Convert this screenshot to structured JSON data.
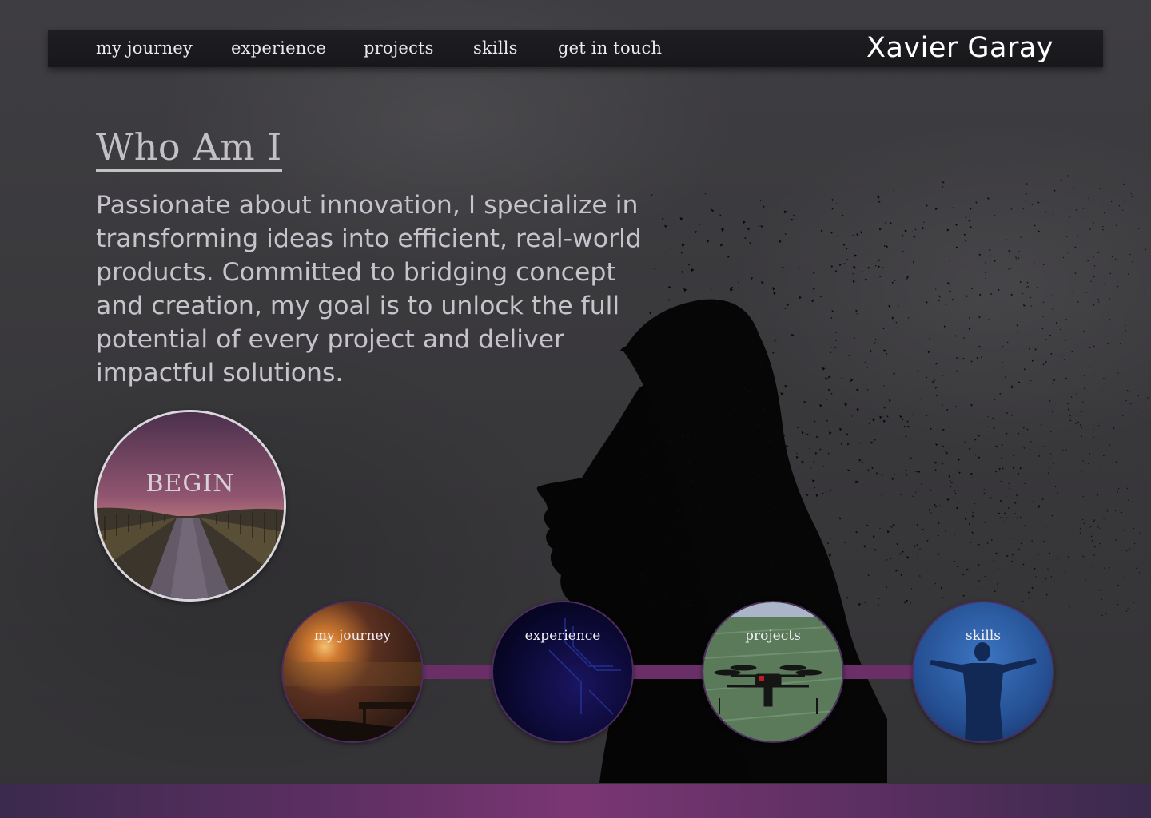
{
  "nav": {
    "links": [
      "my journey",
      "experience",
      "projects",
      "skills",
      "get in touch"
    ],
    "brand": "Xavier Garay"
  },
  "hero": {
    "title": "Who Am I",
    "intro": "Passionate about innovation, I specialize in transforming ideas into efficient, real-world products. Committed to bridging concept and creation, my goal is to unlock the full potential of every project and deliver impactful solutions."
  },
  "begin": {
    "label": "BEGIN"
  },
  "timeline": {
    "nodes": [
      {
        "label": "my journey",
        "image": "sunset-bench-photo"
      },
      {
        "label": "experience",
        "image": "circuit-board-photo"
      },
      {
        "label": "projects",
        "image": "agricultural-drone-photo"
      },
      {
        "label": "skills",
        "image": "open-arms-silhouette-photo"
      }
    ]
  },
  "colors": {
    "accent": "#6b2f68",
    "nav_background": "#1b1a1e",
    "chalkboard": "#3a393c",
    "footer_gradient": [
      "#3b2a4d",
      "#7a3673",
      "#3a2a4c"
    ]
  },
  "icons": {
    "hero_art": "dispersing-head-silhouette-icon"
  }
}
